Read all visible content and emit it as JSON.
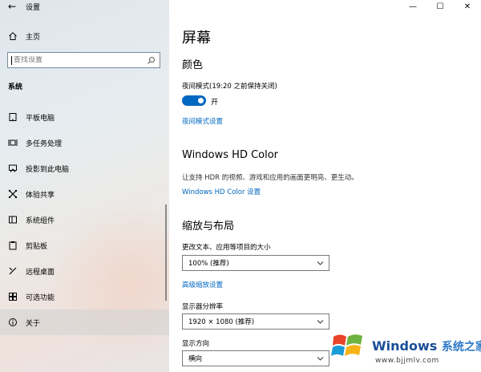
{
  "app": {
    "title": "设置"
  },
  "sidebar": {
    "home_label": "主页",
    "search_placeholder": "查找设置",
    "section_title": "系统",
    "items": [
      {
        "label": "平板电脑",
        "icon": "tablet-icon"
      },
      {
        "label": "多任务处理",
        "icon": "multitask-icon"
      },
      {
        "label": "投影到此电脑",
        "icon": "project-icon"
      },
      {
        "label": "体验共享",
        "icon": "share-icon"
      },
      {
        "label": "系统组件",
        "icon": "components-icon"
      },
      {
        "label": "剪贴板",
        "icon": "clipboard-icon"
      },
      {
        "label": "远程桌面",
        "icon": "remote-desktop-icon"
      },
      {
        "label": "可选功能",
        "icon": "optional-features-icon"
      },
      {
        "label": "关于",
        "icon": "info-icon",
        "selected": true
      }
    ]
  },
  "main": {
    "title": "屏幕",
    "color": {
      "heading": "颜色",
      "night_light_label": "夜间模式(19:20 之前保持关闭)",
      "toggle_state": "开",
      "night_light_settings_link": "夜间模式设置"
    },
    "hdr": {
      "heading": "Windows HD Color",
      "description": "让支持 HDR 的视频、游戏和应用的画面更明亮、更生动。",
      "settings_link": "Windows HD Color 设置"
    },
    "layout": {
      "heading": "缩放与布局",
      "scale_label": "更改文本、应用等项目的大小",
      "scale_value": "100% (推荐)",
      "advanced_link": "高级缩放设置",
      "resolution_label": "显示器分辨率",
      "resolution_value": "1920 × 1080 (推荐)",
      "orientation_label": "显示方向",
      "orientation_value": "横向"
    }
  },
  "watermark": {
    "brand": "Windows",
    "brand_cn": "系统之家",
    "url": "www.bjjmlv.com"
  },
  "colors": {
    "accent": "#0067c0",
    "link": "#0067c0"
  }
}
